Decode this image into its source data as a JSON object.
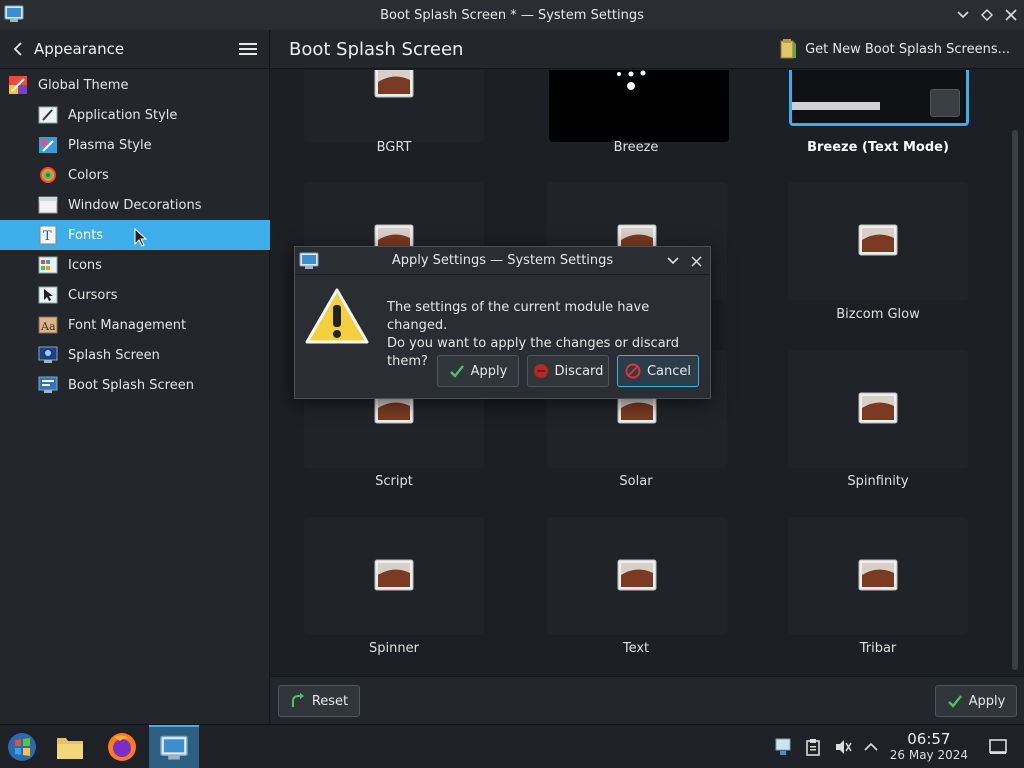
{
  "window": {
    "title": "Boot Splash Screen * — System Settings"
  },
  "sidebar": {
    "header_label": "Appearance",
    "items": [
      {
        "label": "Global Theme",
        "icon": "global-theme-icon",
        "level": "top"
      },
      {
        "label": "Application Style",
        "icon": "application-style-icon",
        "level": "sub"
      },
      {
        "label": "Plasma Style",
        "icon": "plasma-style-icon",
        "level": "sub"
      },
      {
        "label": "Colors",
        "icon": "colors-icon",
        "level": "sub"
      },
      {
        "label": "Window Decorations",
        "icon": "window-decorations-icon",
        "level": "sub"
      },
      {
        "label": "Fonts",
        "icon": "fonts-icon",
        "level": "sub",
        "active": true
      },
      {
        "label": "Icons",
        "icon": "icons-icon",
        "level": "sub"
      },
      {
        "label": "Cursors",
        "icon": "cursors-icon",
        "level": "sub"
      },
      {
        "label": "Font Management",
        "icon": "font-management-icon",
        "level": "sub"
      },
      {
        "label": "Splash Screen",
        "icon": "splash-screen-icon",
        "level": "sub"
      },
      {
        "label": "Boot Splash Screen",
        "icon": "boot-splash-screen-icon",
        "level": "sub"
      }
    ]
  },
  "main": {
    "page_title": "Boot Splash Screen",
    "get_new_label": "Get New Boot Splash Screens...",
    "themes": [
      {
        "label": "BGRT",
        "selected": false
      },
      {
        "label": "Breeze",
        "selected": false
      },
      {
        "label": "Breeze (Text Mode)",
        "selected": true
      },
      {
        "label": "",
        "selected": false
      },
      {
        "label": "",
        "selected": false
      },
      {
        "label": "Bizcom Glow",
        "selected": false
      },
      {
        "label": "Script",
        "selected": false
      },
      {
        "label": "Solar",
        "selected": false
      },
      {
        "label": "Spinfinity",
        "selected": false
      },
      {
        "label": "Spinner",
        "selected": false
      },
      {
        "label": "Text",
        "selected": false
      },
      {
        "label": "Tribar",
        "selected": false
      }
    ],
    "reset_label": "Reset",
    "apply_label": "Apply"
  },
  "dialog": {
    "title": "Apply Settings — System Settings",
    "message_line1": "The settings of the current module have changed.",
    "message_line2": "Do you want to apply the changes or discard them?",
    "apply_label": "Apply",
    "discard_label": "Discard",
    "cancel_label": "Cancel"
  },
  "taskbar": {
    "time": "06:57",
    "date": "26 May 2024"
  },
  "colors": {
    "accent": "#3daee9",
    "background": "#1c1f23",
    "panel": "#23272b"
  }
}
